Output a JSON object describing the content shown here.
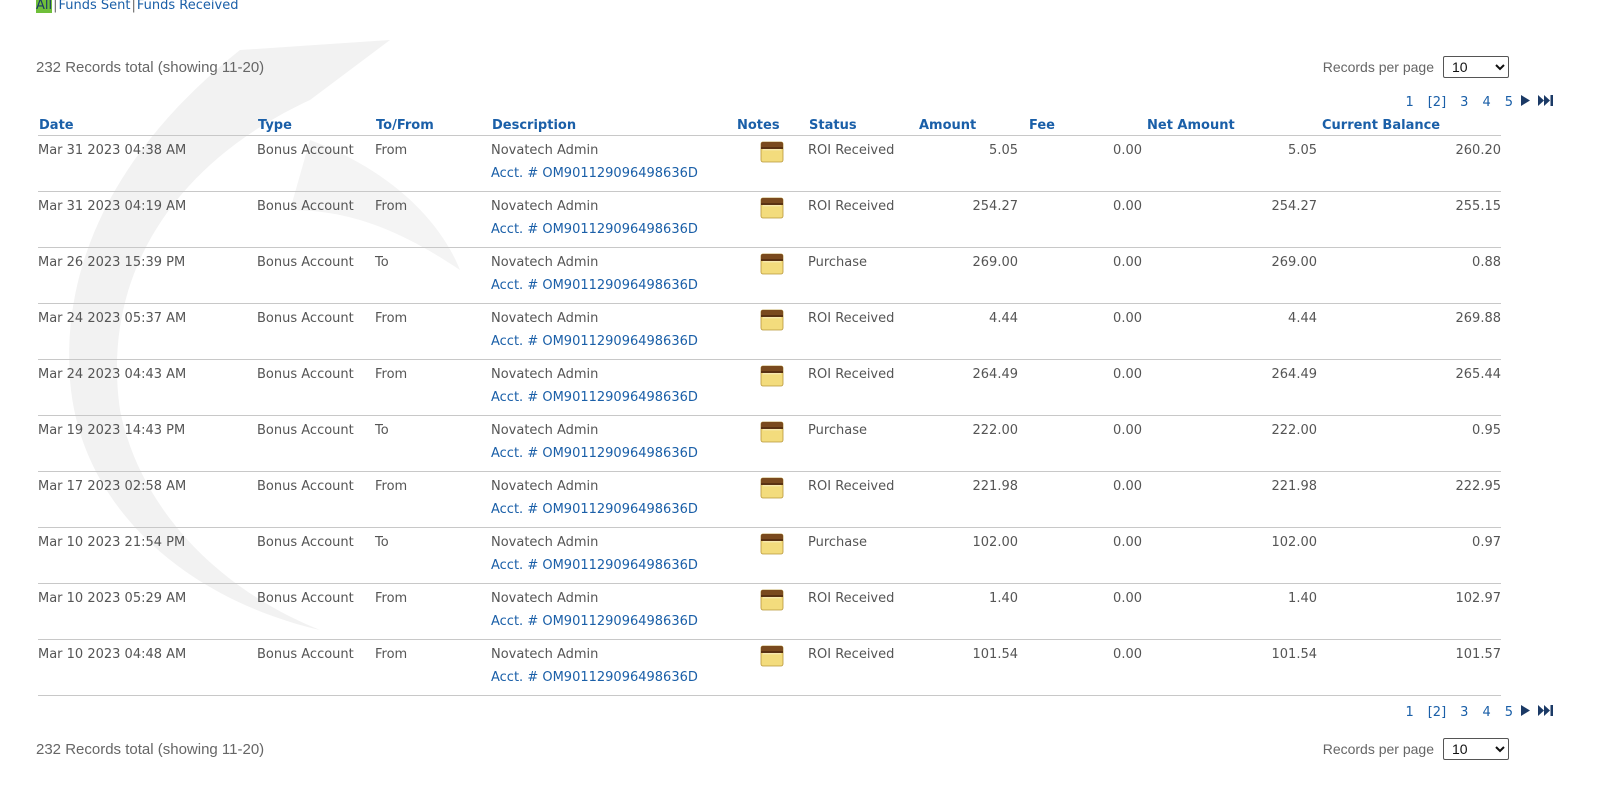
{
  "filters": [
    {
      "label": "All",
      "active": true
    },
    {
      "label": "Funds Sent",
      "active": false
    },
    {
      "label": "Funds Received",
      "active": false
    }
  ],
  "summary": {
    "records_total": "232 Records total (showing 11-20)",
    "records_per_page_label": "Records per page",
    "records_per_page_value": "10"
  },
  "pagination": {
    "pages": [
      "1",
      "[2]",
      "3",
      "4",
      "5"
    ],
    "next_icon": "play-next-icon",
    "last_icon": "fast-forward-last-icon"
  },
  "table": {
    "headers": {
      "date": "Date",
      "type": "Type",
      "to_from": "To/From",
      "description": "Description",
      "notes": "Notes",
      "status": "Status",
      "amount": "Amount",
      "fee": "Fee",
      "net_amount": "Net Amount",
      "current_balance": "Current Balance"
    },
    "note_icon": "notepad-icon",
    "rows": [
      {
        "date": "Mar 31 2023 04:38 AM",
        "type": "Bonus Account",
        "to_from": "From",
        "description": "Novatech Admin",
        "account": "Acct. # OM901129096498636D",
        "status": "ROI Received",
        "amount": "5.05",
        "fee": "0.00",
        "net_amount": "5.05",
        "current_balance": "260.20"
      },
      {
        "date": "Mar 31 2023 04:19 AM",
        "type": "Bonus Account",
        "to_from": "From",
        "description": "Novatech Admin",
        "account": "Acct. # OM901129096498636D",
        "status": "ROI Received",
        "amount": "254.27",
        "fee": "0.00",
        "net_amount": "254.27",
        "current_balance": "255.15"
      },
      {
        "date": "Mar 26 2023 15:39 PM",
        "type": "Bonus Account",
        "to_from": "To",
        "description": "Novatech Admin",
        "account": "Acct. # OM901129096498636D",
        "status": "Purchase",
        "amount": "269.00",
        "fee": "0.00",
        "net_amount": "269.00",
        "current_balance": "0.88"
      },
      {
        "date": "Mar 24 2023 05:37 AM",
        "type": "Bonus Account",
        "to_from": "From",
        "description": "Novatech Admin",
        "account": "Acct. # OM901129096498636D",
        "status": "ROI Received",
        "amount": "4.44",
        "fee": "0.00",
        "net_amount": "4.44",
        "current_balance": "269.88"
      },
      {
        "date": "Mar 24 2023 04:43 AM",
        "type": "Bonus Account",
        "to_from": "From",
        "description": "Novatech Admin",
        "account": "Acct. # OM901129096498636D",
        "status": "ROI Received",
        "amount": "264.49",
        "fee": "0.00",
        "net_amount": "264.49",
        "current_balance": "265.44"
      },
      {
        "date": "Mar 19 2023 14:43 PM",
        "type": "Bonus Account",
        "to_from": "To",
        "description": "Novatech Admin",
        "account": "Acct. # OM901129096498636D",
        "status": "Purchase",
        "amount": "222.00",
        "fee": "0.00",
        "net_amount": "222.00",
        "current_balance": "0.95"
      },
      {
        "date": "Mar 17 2023 02:58 AM",
        "type": "Bonus Account",
        "to_from": "From",
        "description": "Novatech Admin",
        "account": "Acct. # OM901129096498636D",
        "status": "ROI Received",
        "amount": "221.98",
        "fee": "0.00",
        "net_amount": "221.98",
        "current_balance": "222.95"
      },
      {
        "date": "Mar 10 2023 21:54 PM",
        "type": "Bonus Account",
        "to_from": "To",
        "description": "Novatech Admin",
        "account": "Acct. # OM901129096498636D",
        "status": "Purchase",
        "amount": "102.00",
        "fee": "0.00",
        "net_amount": "102.00",
        "current_balance": "0.97"
      },
      {
        "date": "Mar 10 2023 05:29 AM",
        "type": "Bonus Account",
        "to_from": "From",
        "description": "Novatech Admin",
        "account": "Acct. # OM901129096498636D",
        "status": "ROI Received",
        "amount": "1.40",
        "fee": "0.00",
        "net_amount": "1.40",
        "current_balance": "102.97"
      },
      {
        "date": "Mar 10 2023 04:48 AM",
        "type": "Bonus Account",
        "to_from": "From",
        "description": "Novatech Admin",
        "account": "Acct. # OM901129096498636D",
        "status": "ROI Received",
        "amount": "101.54",
        "fee": "0.00",
        "net_amount": "101.54",
        "current_balance": "101.57"
      }
    ]
  },
  "colors": {
    "link": "#1a5fa8",
    "active_filter_bg": "#6fbf3a",
    "text": "#555555",
    "row_border": "#c8c8c8"
  }
}
